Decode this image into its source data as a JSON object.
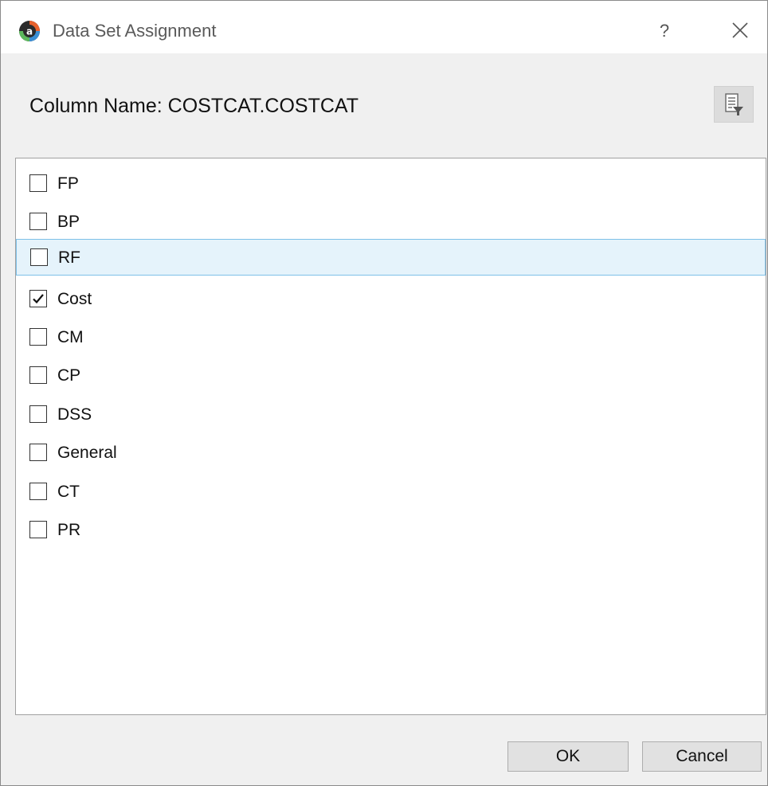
{
  "window": {
    "title": "Data Set Assignment",
    "help_label": "?"
  },
  "header": {
    "column_name": "Column Name: COSTCAT.COSTCAT"
  },
  "icons": {
    "app": "app-logo-icon",
    "close": "close-icon",
    "filter": "document-filter-icon",
    "check": "checkmark-icon"
  },
  "colors": {
    "highlight_bg": "#e5f3fb",
    "highlight_border": "#7ec0e8"
  },
  "items": [
    {
      "label": "FP",
      "checked": false,
      "highlighted": false
    },
    {
      "label": "BP",
      "checked": false,
      "highlighted": false
    },
    {
      "label": "RF",
      "checked": false,
      "highlighted": true
    },
    {
      "label": "Cost",
      "checked": true,
      "highlighted": false
    },
    {
      "label": "CM",
      "checked": false,
      "highlighted": false
    },
    {
      "label": "CP",
      "checked": false,
      "highlighted": false
    },
    {
      "label": "DSS",
      "checked": false,
      "highlighted": false
    },
    {
      "label": "General",
      "checked": false,
      "highlighted": false
    },
    {
      "label": "CT",
      "checked": false,
      "highlighted": false
    },
    {
      "label": "PR",
      "checked": false,
      "highlighted": false
    }
  ],
  "buttons": {
    "ok": "OK",
    "cancel": "Cancel"
  }
}
